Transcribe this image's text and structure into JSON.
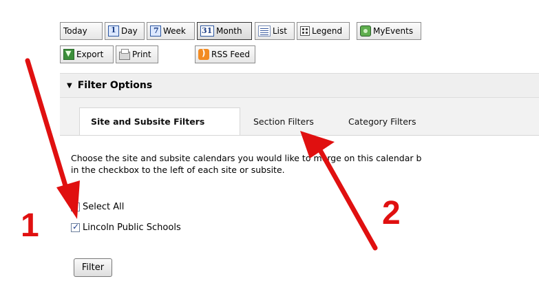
{
  "toolbar": {
    "today": "Today",
    "day": "Day",
    "week": "Week",
    "month": "Month",
    "list": "List",
    "legend": "Legend",
    "myevents": "MyEvents",
    "export": "Export",
    "print": "Print",
    "rss": "RSS Feed"
  },
  "filter_options": {
    "title": "Filter Options"
  },
  "tabs": [
    {
      "label": "Site and Subsite Filters",
      "active": true
    },
    {
      "label": "Section Filters",
      "active": false
    },
    {
      "label": "Category Filters",
      "active": false
    }
  ],
  "content": {
    "line1": "Choose the site and subsite calendars you would like to merge on this calendar b",
    "line2": "in the checkbox to the left of each site or subsite.",
    "select_all": "Select All",
    "site_name": "Lincoln Public Schools",
    "select_all_checked": false,
    "site_checked": true,
    "filter_button": "Filter"
  },
  "annotations": {
    "one": "1",
    "two": "2",
    "color": "#e01010"
  }
}
